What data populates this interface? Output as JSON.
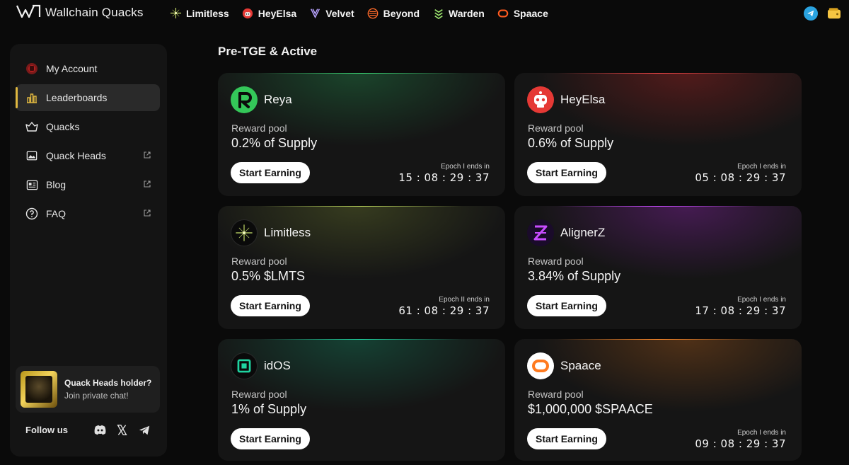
{
  "app": {
    "brand_name": "Wallchain Quacks"
  },
  "topbar": {
    "partners": [
      {
        "label": "Limitless",
        "icon": "limitless-icon",
        "color": "#c8e06a"
      },
      {
        "label": "HeyElsa",
        "icon": "heyelsa-icon",
        "color": "#e53935"
      },
      {
        "label": "Velvet",
        "icon": "velvet-icon",
        "color": "#b9a4ff"
      },
      {
        "label": "Beyond",
        "icon": "beyond-icon",
        "color": "#ff6a2a"
      },
      {
        "label": "Warden",
        "icon": "warden-icon",
        "color": "#9fe870"
      },
      {
        "label": "Spaace",
        "icon": "spaace-icon",
        "color": "#ff5a1f"
      }
    ],
    "telegram_color": "#2aa3e0",
    "wallet_color": "#f5c542"
  },
  "sidebar": {
    "items": [
      {
        "label": "My Account",
        "icon": "account-icon",
        "external": false,
        "active": false
      },
      {
        "label": "Leaderboards",
        "icon": "bar-chart-icon",
        "external": false,
        "active": true
      },
      {
        "label": "Quacks",
        "icon": "basket-icon",
        "external": false,
        "active": false
      },
      {
        "label": "Quack Heads",
        "icon": "image-icon",
        "external": true,
        "active": false
      },
      {
        "label": "Blog",
        "icon": "newspaper-icon",
        "external": true,
        "active": false
      },
      {
        "label": "FAQ",
        "icon": "question-icon",
        "external": true,
        "active": false
      }
    ],
    "holder": {
      "title": "Quack Heads holder?",
      "subtitle": "Join private chat!"
    },
    "follow_label": "Follow us",
    "accent": "#e0b840"
  },
  "main": {
    "section_title": "Pre-TGE & Active",
    "cards": [
      {
        "name": "Reya",
        "pool_label": "Reward pool",
        "pool_value": "0.2% of Supply",
        "cta": "Start Earning",
        "epoch_label": "Epoch I ends in",
        "epoch_time": "15 : 08 : 29 : 37",
        "icon": "reya-logo",
        "accent": "#34c759"
      },
      {
        "name": "HeyElsa",
        "pool_label": "Reward pool",
        "pool_value": "0.6% of Supply",
        "cta": "Start Earning",
        "epoch_label": "Epoch I ends in",
        "epoch_time": "05 : 08 : 29 : 37",
        "icon": "heyelsa-logo",
        "accent": "#e53935"
      },
      {
        "name": "Limitless",
        "pool_label": "Reward pool",
        "pool_value": "0.5% $LMTS",
        "cta": "Start Earning",
        "epoch_label": "Epoch II ends in",
        "epoch_time": "61 : 08 : 29 : 37",
        "icon": "limitless-logo",
        "accent": "#a8c24a"
      },
      {
        "name": "AlignerZ",
        "pool_label": "Reward pool",
        "pool_value": "3.84% of Supply",
        "cta": "Start Earning",
        "epoch_label": "Epoch I ends in",
        "epoch_time": "17 : 08 : 29 : 37",
        "icon": "alignerz-logo",
        "accent": "#b43cff"
      },
      {
        "name": "idOS",
        "pool_label": "Reward pool",
        "pool_value": "1% of Supply",
        "cta": "Start Earning",
        "epoch_label": "",
        "epoch_time": "",
        "icon": "idos-logo",
        "accent": "#1fd3a0"
      },
      {
        "name": "Spaace",
        "pool_label": "Reward pool",
        "pool_value": "$1,000,000 $SPAACE",
        "cta": "Start Earning",
        "epoch_label": "Epoch I ends in",
        "epoch_time": "09 : 08 : 29 : 37",
        "icon": "spaace-logo",
        "accent": "#ff7a1f"
      }
    ]
  }
}
